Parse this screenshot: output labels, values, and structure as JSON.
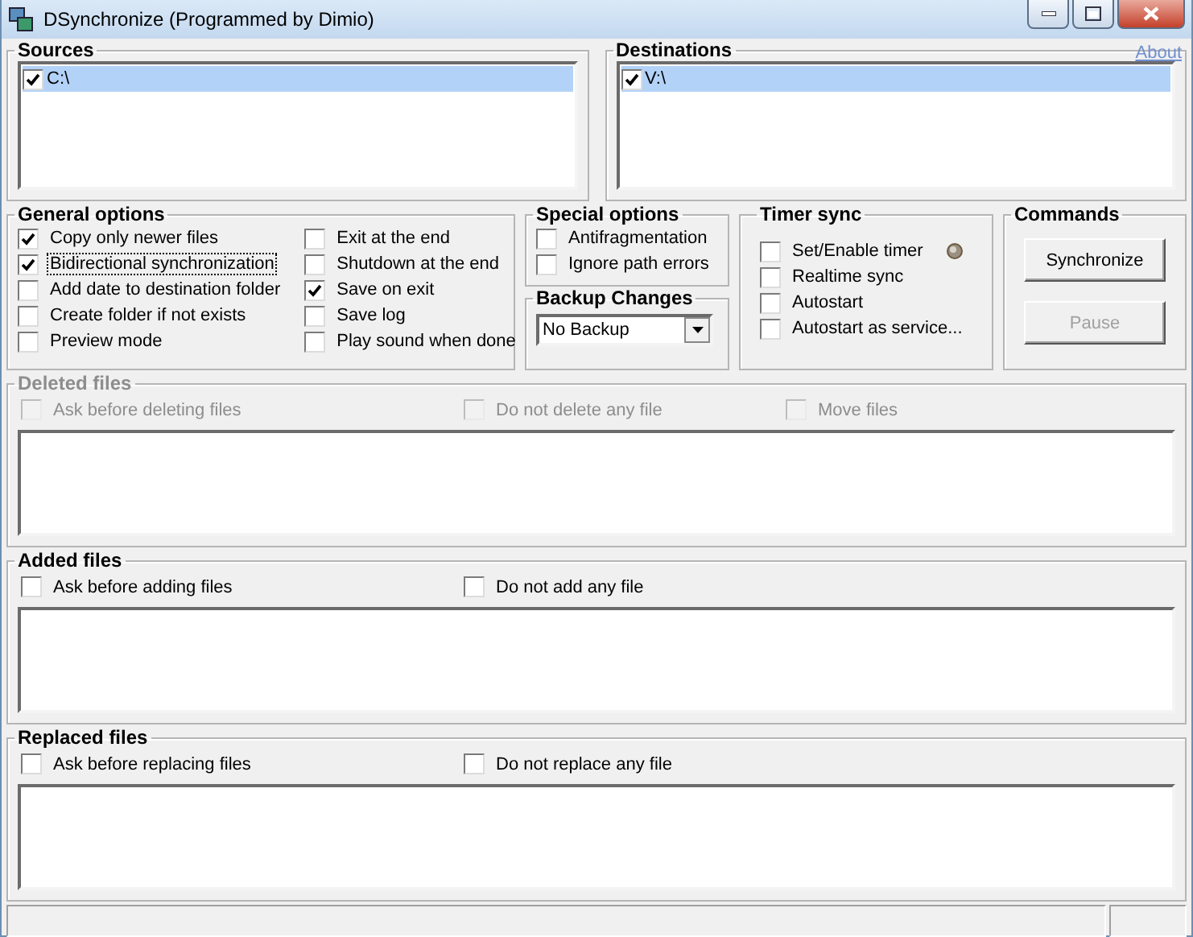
{
  "window": {
    "title": "DSynchronize (Programmed by Dimio)"
  },
  "about_link": "About",
  "sources": {
    "title": "Sources",
    "items": [
      {
        "label": "C:\\",
        "checked": true,
        "selected": true
      }
    ]
  },
  "destinations": {
    "title": "Destinations",
    "items": [
      {
        "label": "V:\\",
        "checked": true,
        "selected": true
      }
    ]
  },
  "general_options": {
    "title": "General options",
    "columns": [
      [
        {
          "label": "Copy only newer files",
          "checked": true,
          "focused": false
        },
        {
          "label": "Bidirectional synchronization",
          "checked": true,
          "focused": true
        },
        {
          "label": "Add date to destination folder",
          "checked": false,
          "focused": false
        },
        {
          "label": "Create folder if not exists",
          "checked": false,
          "focused": false
        },
        {
          "label": "Preview mode",
          "checked": false,
          "focused": false
        }
      ],
      [
        {
          "label": "Exit at the end",
          "checked": false,
          "focused": false
        },
        {
          "label": "Shutdown at the end",
          "checked": false,
          "focused": false
        },
        {
          "label": "Save on exit",
          "checked": true,
          "focused": false
        },
        {
          "label": "Save log",
          "checked": false,
          "focused": false
        },
        {
          "label": "Play sound when done",
          "checked": false,
          "focused": false
        }
      ]
    ]
  },
  "special_options": {
    "title": "Special options",
    "items": [
      {
        "label": "Antifragmentation",
        "checked": false
      },
      {
        "label": "Ignore path errors",
        "checked": false
      }
    ]
  },
  "backup_changes": {
    "title": "Backup Changes",
    "value": "No Backup"
  },
  "timer_sync": {
    "title": "Timer sync",
    "items": [
      {
        "label": "Set/Enable timer",
        "checked": false,
        "indicator": true
      },
      {
        "label": "Realtime sync",
        "checked": false,
        "indicator": false
      },
      {
        "label": "Autostart",
        "checked": false,
        "indicator": false
      },
      {
        "label": "Autostart as service...",
        "checked": false,
        "indicator": false
      }
    ]
  },
  "commands": {
    "title": "Commands",
    "buttons": [
      {
        "label": "Synchronize",
        "disabled": false
      },
      {
        "label": "Pause",
        "disabled": true
      }
    ]
  },
  "file_sections": [
    {
      "title": "Deleted files",
      "disabled": true,
      "options": [
        {
          "label": "Ask before deleting files",
          "checked": false
        },
        {
          "label": "Do not delete any file",
          "checked": false
        },
        {
          "label": "Move files",
          "checked": false
        }
      ]
    },
    {
      "title": "Added files",
      "disabled": false,
      "options": [
        {
          "label": "Ask before adding files",
          "checked": false
        },
        {
          "label": "Do not add any file",
          "checked": false
        }
      ]
    },
    {
      "title": "Replaced files",
      "disabled": false,
      "options": [
        {
          "label": "Ask before replacing files",
          "checked": false
        },
        {
          "label": "Do not replace any file",
          "checked": false
        }
      ]
    }
  ]
}
